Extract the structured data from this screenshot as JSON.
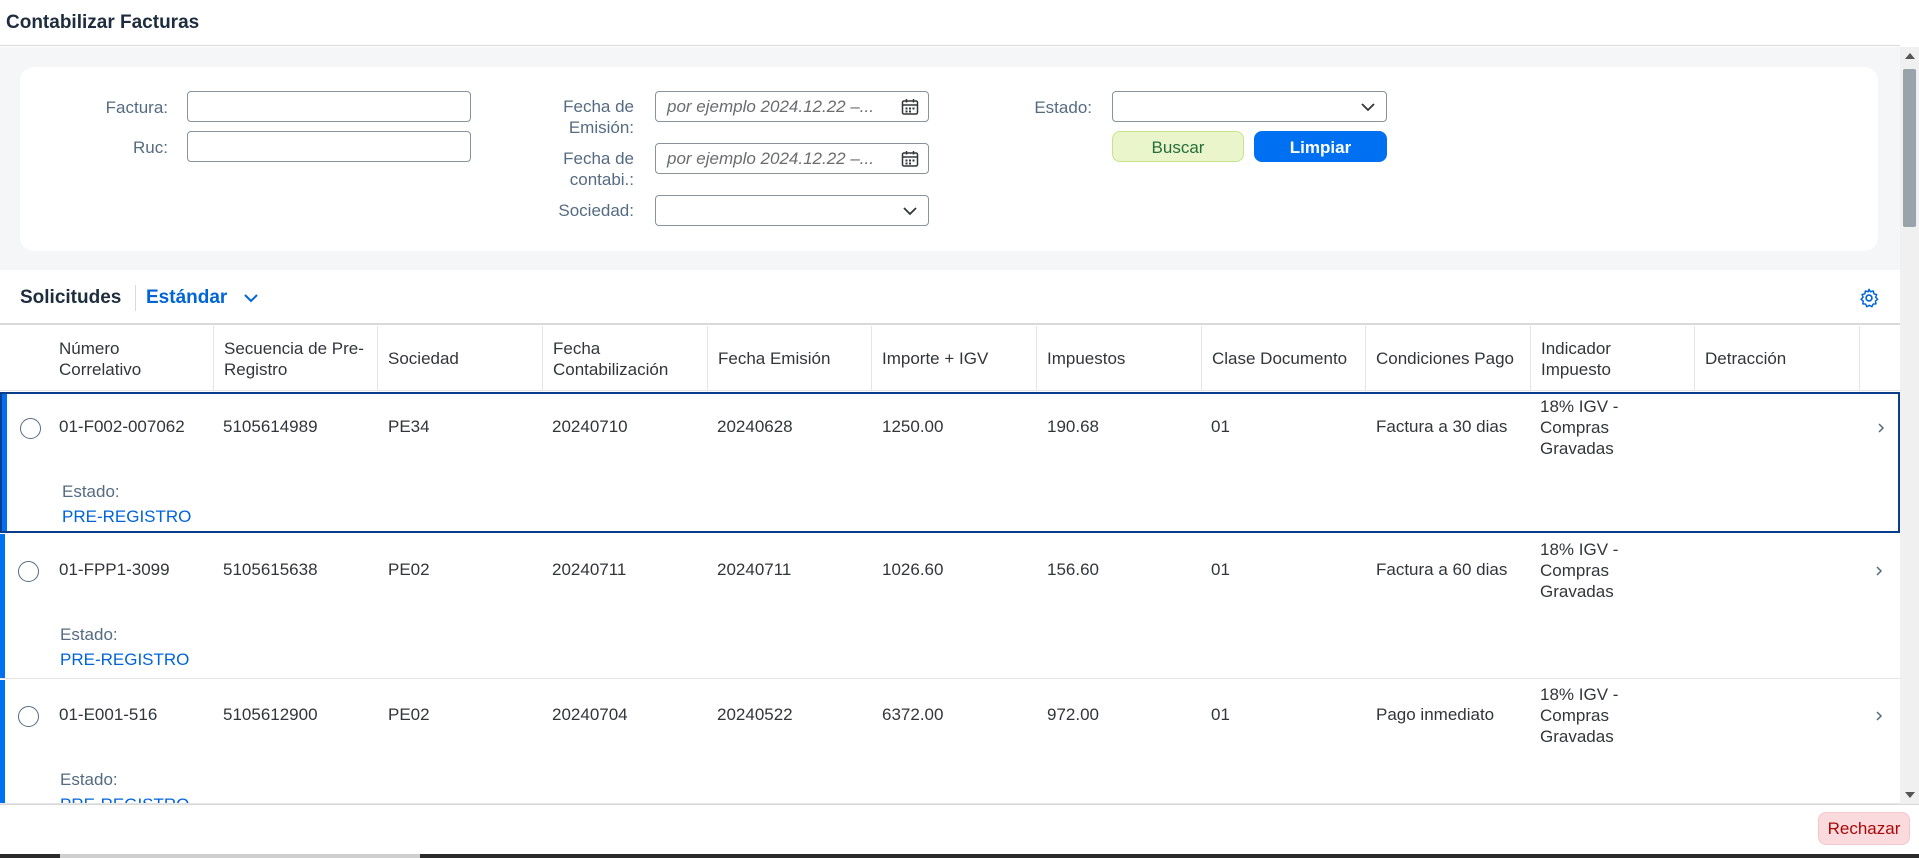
{
  "page": {
    "title": "Contabilizar Facturas"
  },
  "filters": {
    "factura_label": "Factura:",
    "factura_value": "",
    "ruc_label": "Ruc:",
    "ruc_value": "",
    "fecha_emision_label_1": "Fecha de",
    "fecha_emision_label_2": "Emisión:",
    "fecha_emision_placeholder": "por ejemplo 2024.12.22 –...",
    "fecha_contab_label_1": "Fecha de",
    "fecha_contab_label_2": "contabi.:",
    "fecha_contab_placeholder": "por ejemplo 2024.12.22 –...",
    "sociedad_label": "Sociedad:",
    "sociedad_value": "",
    "estado_label": "Estado:",
    "estado_value": "",
    "buscar": "Buscar",
    "limpiar": "Limpiar"
  },
  "table": {
    "title": "Solicitudes",
    "variant": "Estándar",
    "columns": [
      "Número Correlativo",
      "Secuencia de Pre-Registro",
      "Sociedad",
      "Fecha Contabilización",
      "Fecha Emisión",
      "Importe + IGV",
      "Impuestos",
      "Clase Documento",
      "Condiciones Pago",
      "Indicador Impuesto",
      "Detracción"
    ],
    "estado_label": "Estado:",
    "rows": [
      {
        "numero": "01-F002-007062",
        "secuencia": "5105614989",
        "sociedad": "PE34",
        "fecha_contab": "20240710",
        "fecha_emision": "20240628",
        "importe": "1250.00",
        "impuestos": "190.68",
        "clase": "01",
        "condiciones": "Factura a 30 dias",
        "indicador": "18% IGV - Compras Gravadas",
        "detraccion": "",
        "estado": "PRE-REGISTRO"
      },
      {
        "numero": "01-FPP1-3099",
        "secuencia": "5105615638",
        "sociedad": "PE02",
        "fecha_contab": "20240711",
        "fecha_emision": "20240711",
        "importe": "1026.60",
        "impuestos": "156.60",
        "clase": "01",
        "condiciones": "Factura a 60 dias",
        "indicador": "18% IGV - Compras Gravadas",
        "detraccion": "",
        "estado": "PRE-REGISTRO"
      },
      {
        "numero": "01-E001-516",
        "secuencia": "5105612900",
        "sociedad": "PE02",
        "fecha_contab": "20240704",
        "fecha_emision": "20240522",
        "importe": "6372.00",
        "impuestos": "972.00",
        "clase": "01",
        "condiciones": "Pago inmediato",
        "indicador": "18% IGV - Compras Gravadas",
        "detraccion": "",
        "estado": "PRE-REGISTRO"
      }
    ]
  },
  "footer": {
    "rechazar": "Rechazar"
  },
  "colors": {
    "accent": "#0070f2",
    "link": "#0064d9",
    "reject": "#aa0808"
  }
}
